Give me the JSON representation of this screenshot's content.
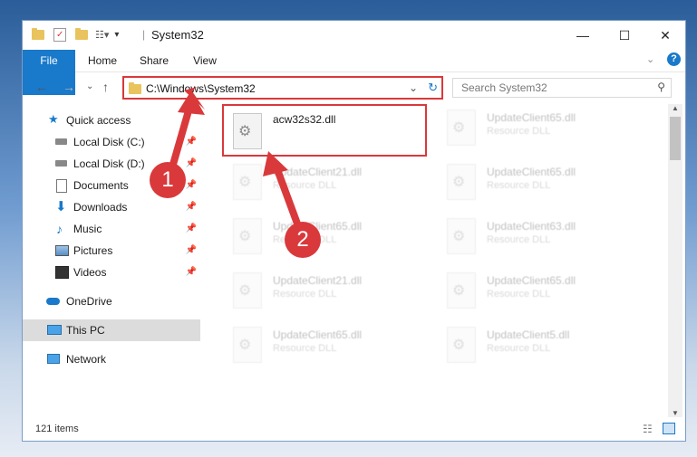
{
  "window": {
    "title": "System32"
  },
  "window_controls": {
    "minimize": "—",
    "maximize": "☐",
    "close": "✕"
  },
  "ribbon": {
    "tabs": [
      {
        "label": "File"
      },
      {
        "label": "Home"
      },
      {
        "label": "Share"
      },
      {
        "label": "View"
      }
    ]
  },
  "address": {
    "path": "C:\\Windows\\System32"
  },
  "search": {
    "placeholder": "Search System32"
  },
  "nav": {
    "quick_access": "Quick access",
    "items": [
      {
        "label": "Local Disk (C:)"
      },
      {
        "label": "Local Disk (D:)"
      },
      {
        "label": "Documents"
      },
      {
        "label": "Downloads"
      },
      {
        "label": "Music"
      },
      {
        "label": "Pictures"
      },
      {
        "label": "Videos"
      }
    ],
    "onedrive": "OneDrive",
    "this_pc": "This PC",
    "network": "Network"
  },
  "files": {
    "highlighted": {
      "name": "acw32s32.dll"
    },
    "faded": [
      {
        "name": "UpdateClient65.dll",
        "type": "Resource DLL"
      },
      {
        "name": "UpdateClient21.dll",
        "type": "Resource DLL"
      },
      {
        "name": "UpdateClient65.dll",
        "type": "Resource DLL"
      },
      {
        "name": "UpdateClient65.dll",
        "type": "Resource DLL"
      },
      {
        "name": "UpdateClient63.dll",
        "type": "Resource DLL"
      },
      {
        "name": "UpdateClient21.dll",
        "type": "Resource DLL"
      },
      {
        "name": "UpdateClient65.dll",
        "type": "Resource DLL"
      },
      {
        "name": "UpdateClient65.dll",
        "type": "Resource DLL"
      },
      {
        "name": "UpdateClient5.dll",
        "type": "Resource DLL"
      }
    ]
  },
  "status": {
    "count": "121 items"
  },
  "annotations": {
    "step1": "1",
    "step2": "2",
    "color": "#d9393b"
  }
}
